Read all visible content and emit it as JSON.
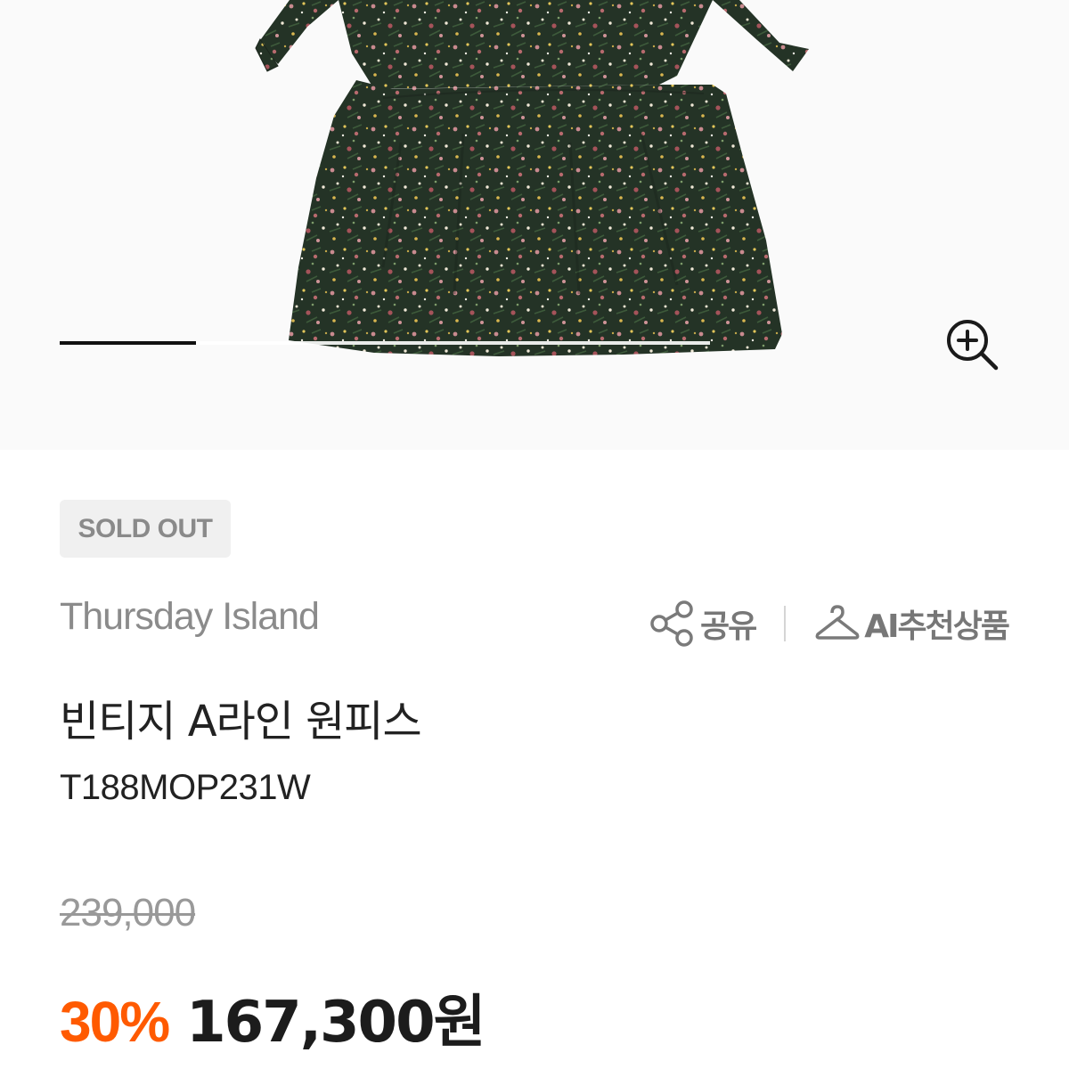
{
  "gallery": {
    "image_alt": "",
    "slide_progress": 0.21,
    "zoom_icon": "zoom-in-icon"
  },
  "product": {
    "status_badge": "SOLD OUT",
    "brand": "Thursday Island",
    "name": "빈티지 A라인 원피스",
    "code": "T188MOP231W",
    "original_price": "239,000",
    "discount_rate": "30%",
    "sale_price": "167,300원"
  },
  "actions": {
    "share_label": "공유",
    "share_icon": "share-icon",
    "ai_label": "AI추천상품",
    "ai_icon": "hanger-icon"
  },
  "colors": {
    "accent": "#ff5a00",
    "dress_base": "#243326"
  }
}
